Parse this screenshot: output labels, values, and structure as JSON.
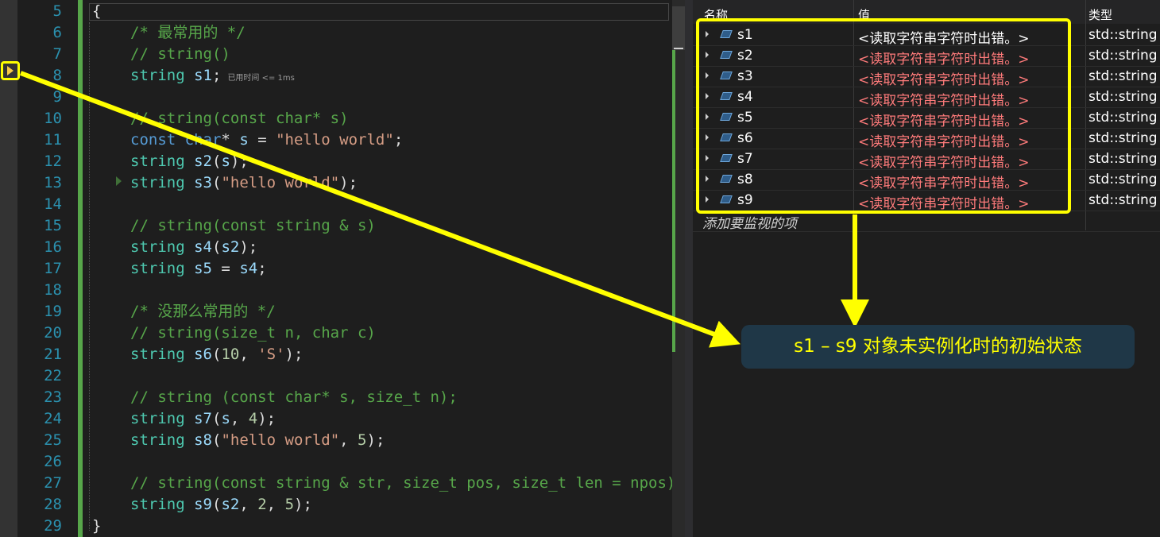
{
  "editor": {
    "lines": [
      {
        "num": "5",
        "parts": [
          {
            "t": "p",
            "v": "{"
          }
        ]
      },
      {
        "num": "6",
        "indent": 1,
        "parts": [
          {
            "t": "c",
            "v": "/* 最常用的 */"
          }
        ]
      },
      {
        "num": "7",
        "indent": 1,
        "parts": [
          {
            "t": "c",
            "v": "// string()"
          }
        ]
      },
      {
        "num": "8",
        "indent": 1,
        "parts": [
          {
            "t": "t",
            "v": "string"
          },
          {
            "t": "p",
            "v": " "
          },
          {
            "t": "v",
            "v": "s1"
          },
          {
            "t": "p",
            "v": ";"
          }
        ],
        "perf": "已用时间 <= 1ms"
      },
      {
        "num": "9",
        "parts": []
      },
      {
        "num": "10",
        "indent": 1,
        "parts": [
          {
            "t": "c",
            "v": "// string(const char* s)"
          }
        ]
      },
      {
        "num": "11",
        "indent": 1,
        "parts": [
          {
            "t": "k",
            "v": "const"
          },
          {
            "t": "p",
            "v": " "
          },
          {
            "t": "k",
            "v": "char"
          },
          {
            "t": "p",
            "v": "* "
          },
          {
            "t": "v",
            "v": "s"
          },
          {
            "t": "p",
            "v": " = "
          },
          {
            "t": "s",
            "v": "\"hello world\""
          },
          {
            "t": "p",
            "v": ";"
          }
        ]
      },
      {
        "num": "12",
        "indent": 1,
        "parts": [
          {
            "t": "t",
            "v": "string"
          },
          {
            "t": "p",
            "v": " "
          },
          {
            "t": "v",
            "v": "s2"
          },
          {
            "t": "p",
            "v": "("
          },
          {
            "t": "v",
            "v": "s"
          },
          {
            "t": "p",
            "v": ");"
          }
        ]
      },
      {
        "num": "13",
        "indent": 1,
        "parts": [
          {
            "t": "t",
            "v": "string"
          },
          {
            "t": "p",
            "v": " "
          },
          {
            "t": "v",
            "v": "s3"
          },
          {
            "t": "p",
            "v": "("
          },
          {
            "t": "s",
            "v": "\"hello world\""
          },
          {
            "t": "p",
            "v": ");"
          }
        ]
      },
      {
        "num": "14",
        "parts": []
      },
      {
        "num": "15",
        "indent": 1,
        "parts": [
          {
            "t": "c",
            "v": "// string(const string & s)"
          }
        ]
      },
      {
        "num": "16",
        "indent": 1,
        "parts": [
          {
            "t": "t",
            "v": "string"
          },
          {
            "t": "p",
            "v": " "
          },
          {
            "t": "v",
            "v": "s4"
          },
          {
            "t": "p",
            "v": "("
          },
          {
            "t": "v",
            "v": "s2"
          },
          {
            "t": "p",
            "v": ");"
          }
        ]
      },
      {
        "num": "17",
        "indent": 1,
        "parts": [
          {
            "t": "t",
            "v": "string"
          },
          {
            "t": "p",
            "v": " "
          },
          {
            "t": "v",
            "v": "s5"
          },
          {
            "t": "p",
            "v": " = "
          },
          {
            "t": "v",
            "v": "s4"
          },
          {
            "t": "p",
            "v": ";"
          }
        ]
      },
      {
        "num": "18",
        "parts": []
      },
      {
        "num": "19",
        "indent": 1,
        "parts": [
          {
            "t": "c",
            "v": "/* 没那么常用的 */"
          }
        ]
      },
      {
        "num": "20",
        "indent": 1,
        "parts": [
          {
            "t": "c",
            "v": "// string(size_t n, char c)"
          }
        ]
      },
      {
        "num": "21",
        "indent": 1,
        "parts": [
          {
            "t": "t",
            "v": "string"
          },
          {
            "t": "p",
            "v": " "
          },
          {
            "t": "v",
            "v": "s6"
          },
          {
            "t": "p",
            "v": "("
          },
          {
            "t": "n",
            "v": "10"
          },
          {
            "t": "p",
            "v": ", "
          },
          {
            "t": "s",
            "v": "'S'"
          },
          {
            "t": "p",
            "v": ");"
          }
        ]
      },
      {
        "num": "22",
        "parts": []
      },
      {
        "num": "23",
        "indent": 1,
        "parts": [
          {
            "t": "c",
            "v": "// string (const char* s, size_t n);"
          }
        ]
      },
      {
        "num": "24",
        "indent": 1,
        "parts": [
          {
            "t": "t",
            "v": "string"
          },
          {
            "t": "p",
            "v": " "
          },
          {
            "t": "v",
            "v": "s7"
          },
          {
            "t": "p",
            "v": "("
          },
          {
            "t": "v",
            "v": "s"
          },
          {
            "t": "p",
            "v": ", "
          },
          {
            "t": "n",
            "v": "4"
          },
          {
            "t": "p",
            "v": ");"
          }
        ]
      },
      {
        "num": "25",
        "indent": 1,
        "parts": [
          {
            "t": "t",
            "v": "string"
          },
          {
            "t": "p",
            "v": " "
          },
          {
            "t": "v",
            "v": "s8"
          },
          {
            "t": "p",
            "v": "("
          },
          {
            "t": "s",
            "v": "\"hello world\""
          },
          {
            "t": "p",
            "v": ", "
          },
          {
            "t": "n",
            "v": "5"
          },
          {
            "t": "p",
            "v": ");"
          }
        ]
      },
      {
        "num": "26",
        "parts": []
      },
      {
        "num": "27",
        "indent": 1,
        "parts": [
          {
            "t": "c",
            "v": "// string(const string & str, size_t pos, size_t len = npos);"
          }
        ]
      },
      {
        "num": "28",
        "indent": 1,
        "parts": [
          {
            "t": "t",
            "v": "string"
          },
          {
            "t": "p",
            "v": " "
          },
          {
            "t": "v",
            "v": "s9"
          },
          {
            "t": "p",
            "v": "("
          },
          {
            "t": "v",
            "v": "s2"
          },
          {
            "t": "p",
            "v": ", "
          },
          {
            "t": "n",
            "v": "2"
          },
          {
            "t": "p",
            "v": ", "
          },
          {
            "t": "n",
            "v": "5"
          },
          {
            "t": "p",
            "v": ");"
          }
        ]
      },
      {
        "num": "29",
        "parts": [
          {
            "t": "p",
            "v": "}"
          }
        ]
      }
    ]
  },
  "watch": {
    "headers": {
      "name": "名称",
      "value": "值",
      "type": "类型"
    },
    "rows": [
      {
        "name": "s1",
        "value": "<读取字符串字符时出错。>",
        "type": "std::string"
      },
      {
        "name": "s2",
        "value": "<读取字符串字符时出错。>",
        "type": "std::string"
      },
      {
        "name": "s3",
        "value": "<读取字符串字符时出错。>",
        "type": "std::string"
      },
      {
        "name": "s4",
        "value": "<读取字符串字符时出错。>",
        "type": "std::string"
      },
      {
        "name": "s5",
        "value": "<读取字符串字符时出错。>",
        "type": "std::string"
      },
      {
        "name": "s6",
        "value": "<读取字符串字符时出错。>",
        "type": "std::string"
      },
      {
        "name": "s7",
        "value": "<读取字符串字符时出错。>",
        "type": "std::string"
      },
      {
        "name": "s8",
        "value": "<读取字符串字符时出错。>",
        "type": "std::string"
      },
      {
        "name": "s9",
        "value": "<读取字符串字符时出错。>",
        "type": "std::string"
      }
    ],
    "add_placeholder": "添加要监视的项"
  },
  "annotation": {
    "callout_text": "s1 – s9 对象未实例化时的初始状态",
    "color": "#ffff00"
  },
  "icons": {
    "execution_pointer": "current-statement-arrow-icon",
    "variable": "variable-object-icon"
  }
}
